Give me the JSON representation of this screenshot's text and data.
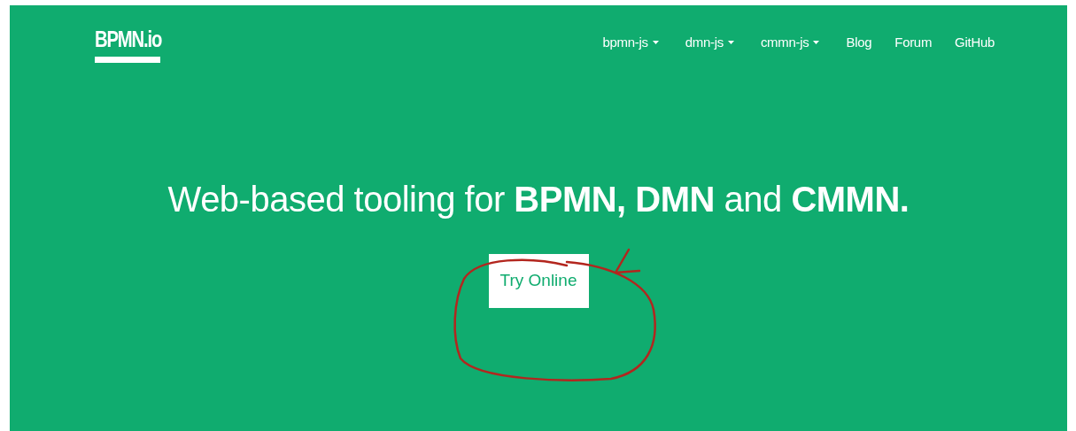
{
  "logo": {
    "text": "BPMN.io"
  },
  "nav": [
    {
      "label": "bpmn-js",
      "kind": "dropdown"
    },
    {
      "label": "dmn-js",
      "kind": "dropdown"
    },
    {
      "label": "cmmn-js",
      "kind": "dropdown"
    },
    {
      "label": "Blog",
      "kind": "link"
    },
    {
      "label": "Forum",
      "kind": "link"
    },
    {
      "label": "GitHub",
      "kind": "link"
    }
  ],
  "hero": {
    "headline": "Web-based tooling for **BPMN, DMN** and **CMMN.**",
    "button": "Try Online"
  }
}
